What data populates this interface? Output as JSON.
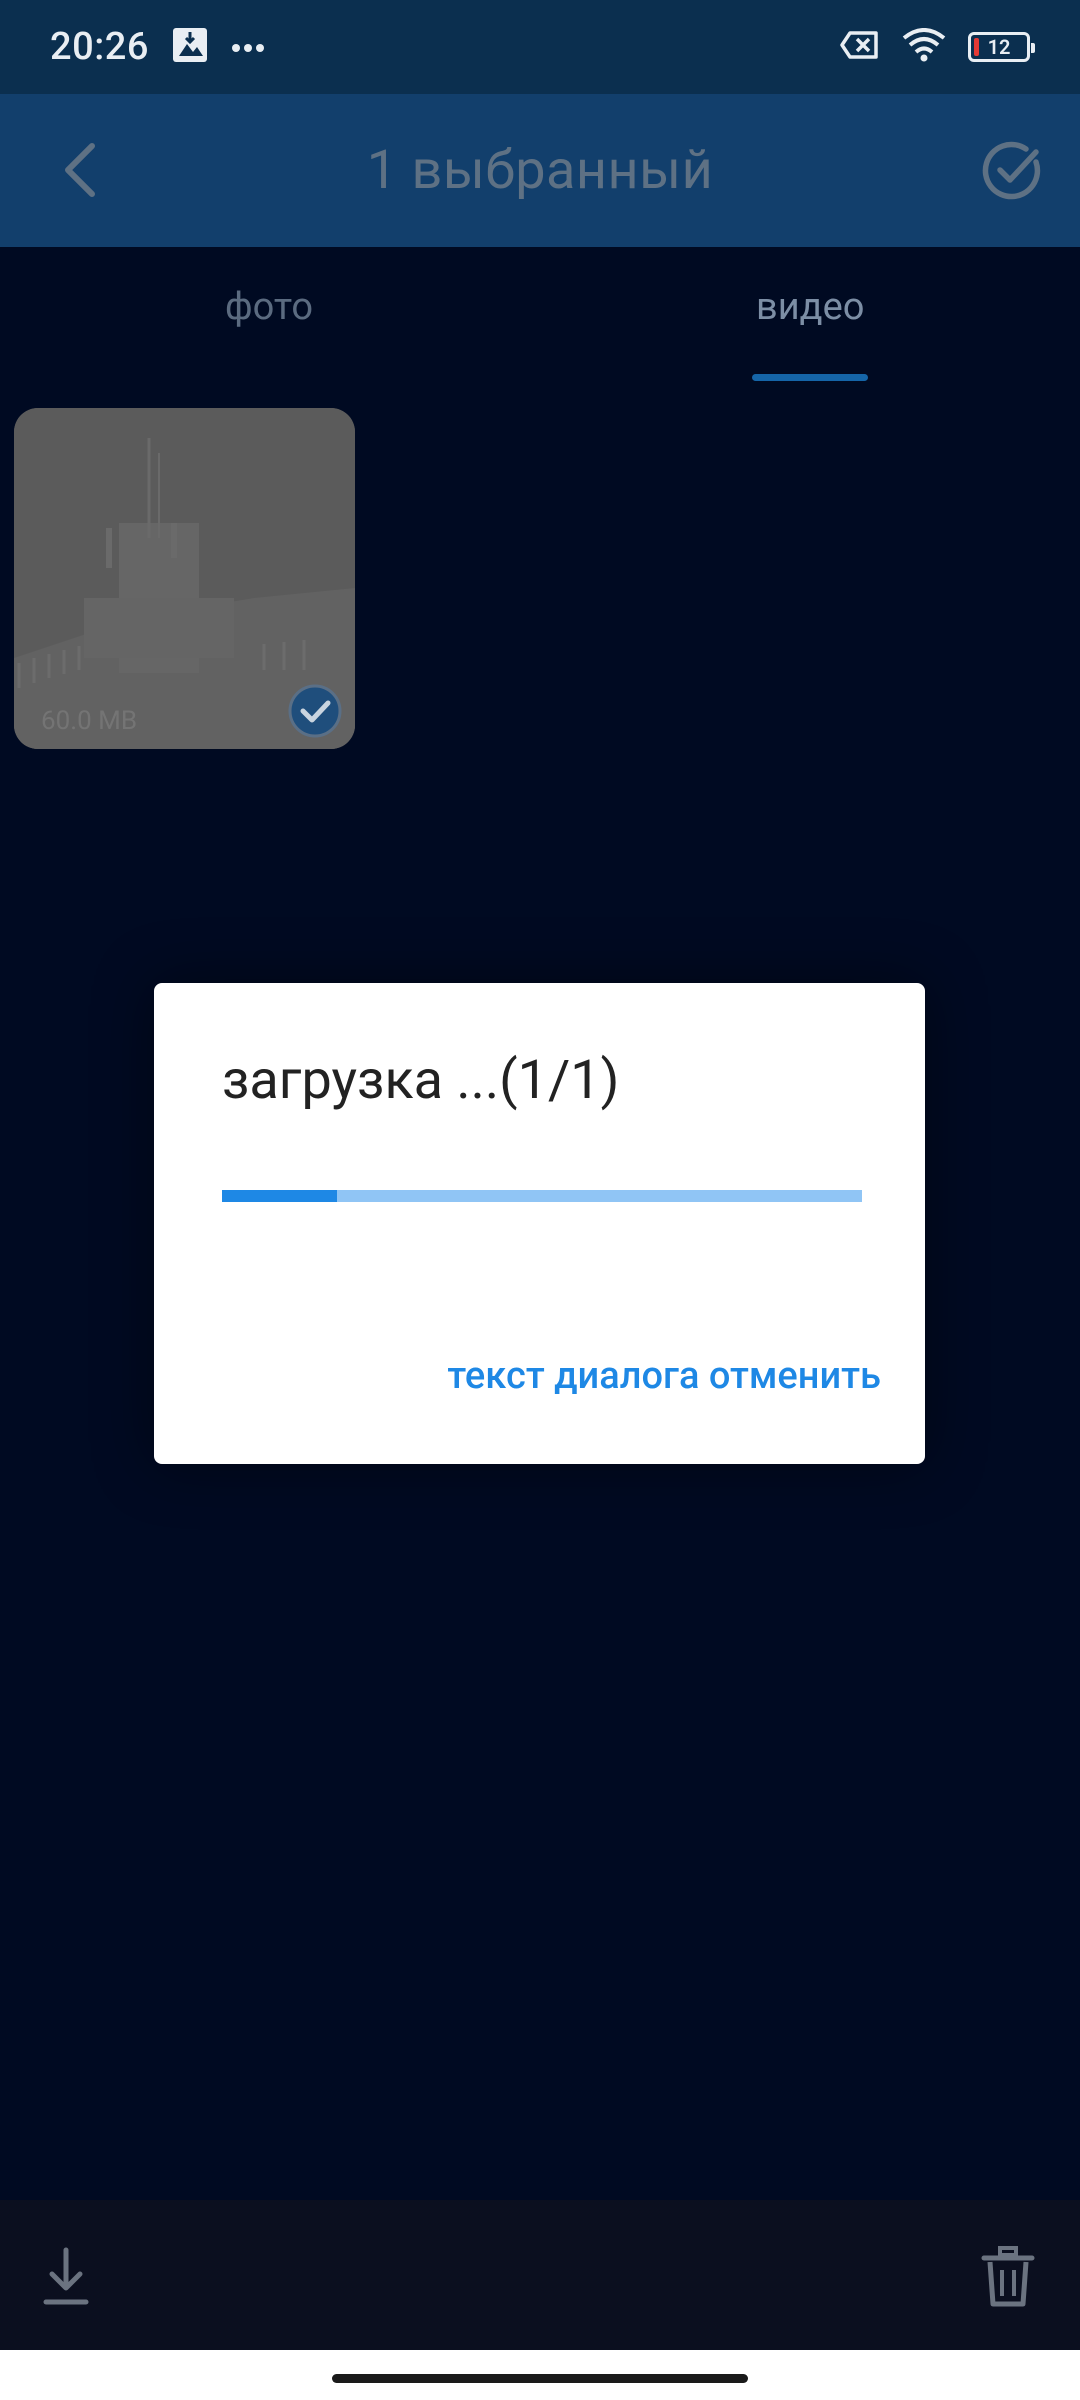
{
  "status_bar": {
    "time": "20:26",
    "icons": [
      "gallery-sync-icon",
      "more-dots-icon",
      "no-sim-icon",
      "wifi-icon",
      "battery-icon"
    ],
    "battery_level": "12"
  },
  "app_bar": {
    "title": "1 выбранный",
    "back_icon": "chevron-left-icon",
    "confirm_icon": "check-circle-icon"
  },
  "tabs": [
    {
      "label": "фото",
      "active": false
    },
    {
      "label": "видео",
      "active": true
    }
  ],
  "media": [
    {
      "size": "60.0 MB",
      "selected": true
    }
  ],
  "dialog": {
    "title": "загрузка ...(1/1)",
    "progress": 0.18,
    "cancel_label": "текст диалога отменить"
  },
  "bottom_bar": {
    "download_icon": "download-icon",
    "delete_icon": "trash-icon"
  },
  "colors": {
    "accent": "#1e88e5",
    "app_bar": "#123f6c",
    "background": "#000a22"
  }
}
